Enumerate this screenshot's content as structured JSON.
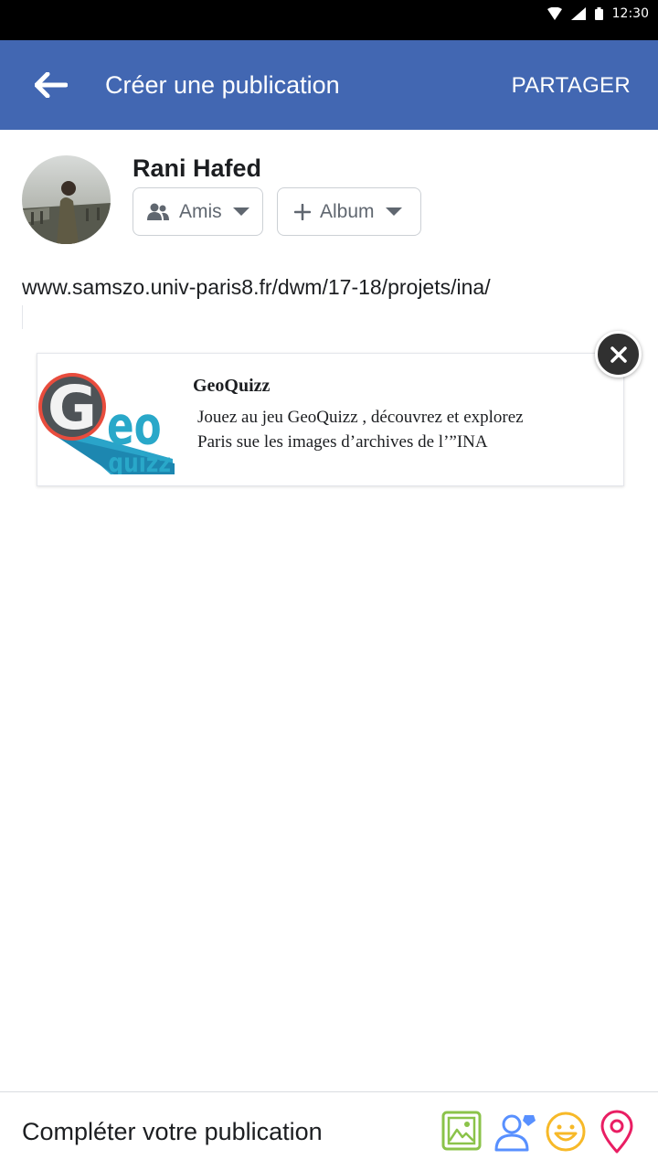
{
  "status_bar": {
    "time": "12:30"
  },
  "app_bar": {
    "title": "Créer une publication",
    "share_label": "PARTAGER"
  },
  "author": {
    "name": "Rani Hafed"
  },
  "audience": {
    "label": "Amis"
  },
  "album": {
    "label": "Album"
  },
  "post": {
    "text": "www.samszo.univ-paris8.fr/dwm/17-18/projets/ina/"
  },
  "link_preview": {
    "logo_text": "GeoQuizz",
    "title": "GeoQuizz",
    "description": "Jouez au jeu GeoQuizz , découvrez et explorez Paris sue les images d’archives de l’”INA"
  },
  "bottom_bar": {
    "label": "Compléter votre publication",
    "icons": [
      "photo-icon",
      "tag-people-icon",
      "feeling-icon",
      "location-icon"
    ]
  },
  "colors": {
    "brand": "#4267b2",
    "photo": "#8bc34a",
    "tag": "#5890ff",
    "feeling": "#f7b928",
    "location": "#e91e63"
  }
}
